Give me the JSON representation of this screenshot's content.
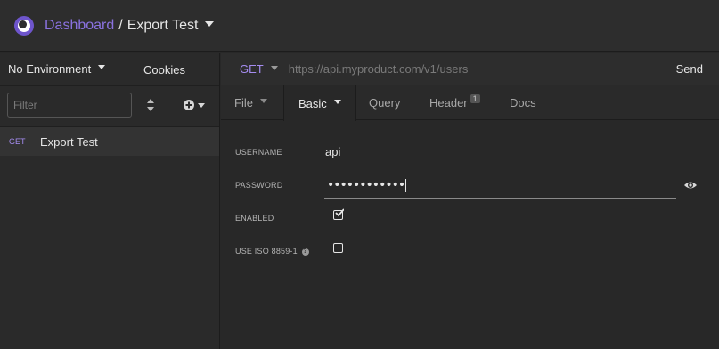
{
  "header": {
    "breadcrumb_link": "Dashboard",
    "separator": "/",
    "workspace": "Export Test",
    "logo_icon": "insomnia-logo-icon",
    "accent_color": "#8a72e0"
  },
  "sidebar": {
    "environment": "No Environment",
    "cookies_label": "Cookies",
    "filter_placeholder": "Filter",
    "requests": [
      {
        "method": "GET",
        "name": "Export Test"
      }
    ]
  },
  "urlbar": {
    "method": "GET",
    "url_placeholder": "https://api.myproduct.com/v1/users",
    "send_label": "Send"
  },
  "tabs": {
    "file": "File",
    "basic": "Basic",
    "query": "Query",
    "header": "Header",
    "header_count": "1",
    "docs": "Docs"
  },
  "auth": {
    "username_label": "USERNAME",
    "username_value": "api",
    "password_label": "PASSWORD",
    "password_value": "••••••••••••",
    "enabled_label": "ENABLED",
    "enabled_checked": true,
    "iso_label": "USE ISO 8859-1",
    "iso_checked": false,
    "help_glyph": "?"
  }
}
